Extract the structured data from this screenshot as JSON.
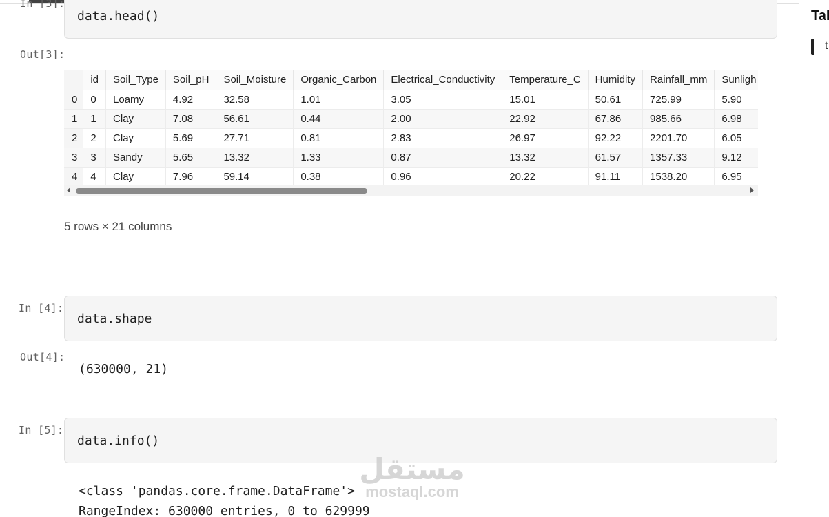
{
  "cells": [
    {
      "in_prompt": "In [3]:",
      "code": "data.head()",
      "out_prompt": "Out[3]:",
      "dataframe": {
        "columns": [
          "",
          "id",
          "Soil_Type",
          "Soil_pH",
          "Soil_Moisture",
          "Organic_Carbon",
          "Electrical_Conductivity",
          "Temperature_C",
          "Humidity",
          "Rainfall_mm",
          "Sunligh"
        ],
        "rows": [
          [
            "0",
            "0",
            "Loamy",
            "4.92",
            "32.58",
            "1.01",
            "3.05",
            "15.01",
            "50.61",
            "725.99",
            "5.90"
          ],
          [
            "1",
            "1",
            "Clay",
            "7.08",
            "56.61",
            "0.44",
            "2.00",
            "22.92",
            "67.86",
            "985.66",
            "6.98"
          ],
          [
            "2",
            "2",
            "Clay",
            "5.69",
            "27.71",
            "0.81",
            "2.83",
            "26.97",
            "92.22",
            "2201.70",
            "6.05"
          ],
          [
            "3",
            "3",
            "Sandy",
            "5.65",
            "13.32",
            "1.33",
            "0.87",
            "13.32",
            "61.57",
            "1357.33",
            "9.12"
          ],
          [
            "4",
            "4",
            "Clay",
            "7.96",
            "59.14",
            "0.38",
            "0.96",
            "20.22",
            "91.11",
            "1538.20",
            "6.95"
          ]
        ],
        "summary": "5 rows × 21 columns"
      }
    },
    {
      "in_prompt": "In [4]:",
      "code": "data.shape",
      "out_prompt": "Out[4]:",
      "output": "(630000, 21)"
    },
    {
      "in_prompt": "In [5]:",
      "code": "data.info()",
      "output_lines": [
        "<class 'pandas.core.frame.DataFrame'>",
        "RangeIndex: 630000 entries, 0 to 629999"
      ]
    }
  ],
  "sidebar": {
    "title": "Tal",
    "item": "t"
  },
  "watermark": {
    "logo": "مستقل",
    "text": "mostaql.com"
  }
}
